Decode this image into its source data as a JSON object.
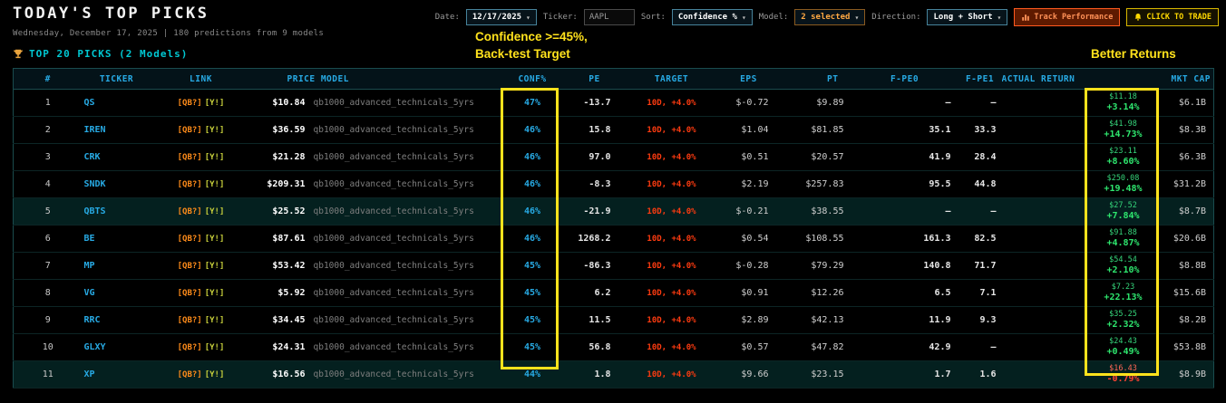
{
  "header": {
    "title": "TODAY'S TOP PICKS",
    "subtitle": "Wednesday, December 17, 2025 | 180 predictions from 9 models"
  },
  "controls": {
    "date_label": "Date:",
    "date_value": "12/17/2025",
    "ticker_label": "Ticker:",
    "ticker_value": "AAPL",
    "sort_label": "Sort:",
    "sort_value": "Confidence %",
    "model_label": "Model:",
    "model_value": "2 selected",
    "direction_label": "Direction:",
    "direction_value": "Long + Short",
    "track_button": "Track Performance",
    "trade_button": "CLICK TO TRADE",
    "chevron_icon": "▾"
  },
  "section": {
    "title": "TOP 20 PICKS (2 Models)"
  },
  "annotations": {
    "confidence_line1": "Confidence >=45%,",
    "confidence_line2": "Back-test Target",
    "returns_note": "Better Returns"
  },
  "colors": {
    "accent_cyan": "#27a9e3",
    "target_red": "#ff3b10",
    "gain_green": "#2ee66e",
    "loss_red": "#ff4433",
    "annotation_yellow": "#ffe21c"
  },
  "table": {
    "headers": [
      "#",
      "TICKER",
      "LINK",
      "PRICE MODEL",
      "CONF%",
      "PE",
      "TARGET",
      "EPS",
      "PT",
      "F-PE0",
      "F-PE1",
      "ACTUAL RETURN",
      "MKT CAP"
    ],
    "rows": [
      {
        "rank": "1",
        "ticker": "QS",
        "link_qb": "[QB?]",
        "link_y": "[Y!]",
        "price": "$10.84",
        "model": "qb1000_advanced_technicals_5yrs",
        "conf": "47%",
        "pe": "-13.7",
        "target": "10D, +4.0%",
        "eps": "$-0.72",
        "pt": "$9.89",
        "fpe0": "—",
        "fpe1": "—",
        "ret_price": "$11.18",
        "ret_pct": "+3.14%",
        "ret_neg": false,
        "mktcap": "$6.1B",
        "tint": false
      },
      {
        "rank": "2",
        "ticker": "IREN",
        "link_qb": "[QB?]",
        "link_y": "[Y!]",
        "price": "$36.59",
        "model": "qb1000_advanced_technicals_5yrs",
        "conf": "46%",
        "pe": "15.8",
        "target": "10D, +4.0%",
        "eps": "$1.04",
        "pt": "$81.85",
        "fpe0": "35.1",
        "fpe1": "33.3",
        "ret_price": "$41.98",
        "ret_pct": "+14.73%",
        "ret_neg": false,
        "mktcap": "$8.3B",
        "tint": false
      },
      {
        "rank": "3",
        "ticker": "CRK",
        "link_qb": "[QB?]",
        "link_y": "[Y!]",
        "price": "$21.28",
        "model": "qb1000_advanced_technicals_5yrs",
        "conf": "46%",
        "pe": "97.0",
        "target": "10D, +4.0%",
        "eps": "$0.51",
        "pt": "$20.57",
        "fpe0": "41.9",
        "fpe1": "28.4",
        "ret_price": "$23.11",
        "ret_pct": "+8.60%",
        "ret_neg": false,
        "mktcap": "$6.3B",
        "tint": false
      },
      {
        "rank": "4",
        "ticker": "SNDK",
        "link_qb": "[QB?]",
        "link_y": "[Y!]",
        "price": "$209.31",
        "model": "qb1000_advanced_technicals_5yrs",
        "conf": "46%",
        "pe": "-8.3",
        "target": "10D, +4.0%",
        "eps": "$2.19",
        "pt": "$257.83",
        "fpe0": "95.5",
        "fpe1": "44.8",
        "ret_price": "$250.08",
        "ret_pct": "+19.48%",
        "ret_neg": false,
        "mktcap": "$31.2B",
        "tint": false
      },
      {
        "rank": "5",
        "ticker": "QBTS",
        "link_qb": "[QB?]",
        "link_y": "[Y!]",
        "price": "$25.52",
        "model": "qb1000_advanced_technicals_5yrs",
        "conf": "46%",
        "pe": "-21.9",
        "target": "10D, +4.0%",
        "eps": "$-0.21",
        "pt": "$38.55",
        "fpe0": "—",
        "fpe1": "—",
        "ret_price": "$27.52",
        "ret_pct": "+7.84%",
        "ret_neg": false,
        "mktcap": "$8.7B",
        "tint": true
      },
      {
        "rank": "6",
        "ticker": "BE",
        "link_qb": "[QB?]",
        "link_y": "[Y!]",
        "price": "$87.61",
        "model": "qb1000_advanced_technicals_5yrs",
        "conf": "46%",
        "pe": "1268.2",
        "target": "10D, +4.0%",
        "eps": "$0.54",
        "pt": "$108.55",
        "fpe0": "161.3",
        "fpe1": "82.5",
        "ret_price": "$91.88",
        "ret_pct": "+4.87%",
        "ret_neg": false,
        "mktcap": "$20.6B",
        "tint": false
      },
      {
        "rank": "7",
        "ticker": "MP",
        "link_qb": "[QB?]",
        "link_y": "[Y!]",
        "price": "$53.42",
        "model": "qb1000_advanced_technicals_5yrs",
        "conf": "45%",
        "pe": "-86.3",
        "target": "10D, +4.0%",
        "eps": "$-0.28",
        "pt": "$79.29",
        "fpe0": "140.8",
        "fpe1": "71.7",
        "ret_price": "$54.54",
        "ret_pct": "+2.10%",
        "ret_neg": false,
        "mktcap": "$8.8B",
        "tint": false
      },
      {
        "rank": "8",
        "ticker": "VG",
        "link_qb": "[QB?]",
        "link_y": "[Y!]",
        "price": "$5.92",
        "model": "qb1000_advanced_technicals_5yrs",
        "conf": "45%",
        "pe": "6.2",
        "target": "10D, +4.0%",
        "eps": "$0.91",
        "pt": "$12.26",
        "fpe0": "6.5",
        "fpe1": "7.1",
        "ret_price": "$7.23",
        "ret_pct": "+22.13%",
        "ret_neg": false,
        "mktcap": "$15.6B",
        "tint": false
      },
      {
        "rank": "9",
        "ticker": "RRC",
        "link_qb": "[QB?]",
        "link_y": "[Y!]",
        "price": "$34.45",
        "model": "qb1000_advanced_technicals_5yrs",
        "conf": "45%",
        "pe": "11.5",
        "target": "10D, +4.0%",
        "eps": "$2.89",
        "pt": "$42.13",
        "fpe0": "11.9",
        "fpe1": "9.3",
        "ret_price": "$35.25",
        "ret_pct": "+2.32%",
        "ret_neg": false,
        "mktcap": "$8.2B",
        "tint": false
      },
      {
        "rank": "10",
        "ticker": "GLXY",
        "link_qb": "[QB?]",
        "link_y": "[Y!]",
        "price": "$24.31",
        "model": "qb1000_advanced_technicals_5yrs",
        "conf": "45%",
        "pe": "56.8",
        "target": "10D, +4.0%",
        "eps": "$0.57",
        "pt": "$47.82",
        "fpe0": "42.9",
        "fpe1": "—",
        "ret_price": "$24.43",
        "ret_pct": "+0.49%",
        "ret_neg": false,
        "mktcap": "$53.8B",
        "tint": false
      },
      {
        "rank": "11",
        "ticker": "XP",
        "link_qb": "[QB?]",
        "link_y": "[Y!]",
        "price": "$16.56",
        "model": "qb1000_advanced_technicals_5yrs",
        "conf": "44%",
        "pe": "1.8",
        "target": "10D, +4.0%",
        "eps": "$9.66",
        "pt": "$23.15",
        "fpe0": "1.7",
        "fpe1": "1.6",
        "ret_price": "$16.43",
        "ret_pct": "-0.79%",
        "ret_neg": true,
        "mktcap": "$8.9B",
        "tint": true
      }
    ]
  }
}
